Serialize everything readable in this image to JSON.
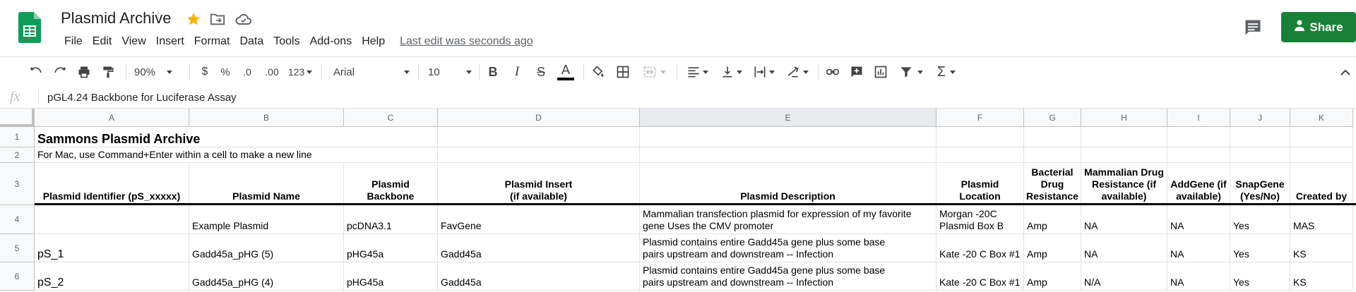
{
  "app": {
    "title": "Plasmid Archive",
    "menus": [
      "File",
      "Edit",
      "View",
      "Insert",
      "Format",
      "Data",
      "Tools",
      "Add-ons",
      "Help"
    ],
    "last_edit": "Last edit was seconds ago",
    "share_label": "Share",
    "colors": {
      "share": "#188038",
      "sheets_green": "#0f9d58",
      "star": "#f4b400"
    }
  },
  "toolbar": {
    "zoom": "90%",
    "currency": "$",
    "percent": "%",
    "dec_less": ".0",
    "dec_more": ".00",
    "more_formats": "123",
    "font": "Arial",
    "font_size": "10",
    "icons": [
      "undo-icon",
      "redo-icon",
      "print-icon",
      "paint-format-icon",
      "bold-icon",
      "italic-icon",
      "strikethrough-icon",
      "text-color-icon",
      "fill-color-icon",
      "borders-icon",
      "merge-icon",
      "align-left-icon",
      "valign-bottom-icon",
      "wrap-icon",
      "rotate-icon",
      "link-icon",
      "comment-add-icon",
      "chart-icon",
      "filter-icon",
      "functions-icon"
    ]
  },
  "formula_bar": {
    "fx": "fx",
    "content": "pGL4.24 Backbone for Luciferase Assay"
  },
  "columns": [
    "A",
    "B",
    "C",
    "D",
    "E",
    "F",
    "G",
    "H",
    "I",
    "J",
    "K"
  ],
  "rows": [
    "1",
    "2",
    "3",
    "4",
    "5",
    "6"
  ],
  "sheet": {
    "title": "Sammons Plasmid Archive",
    "note": "For Mac, use Command+Enter within a cell to make a new line",
    "headers": [
      "Plasmid Identifier (pS_xxxxx)",
      "Plasmid Name",
      "Plasmid Backbone",
      "Plasmid Insert (if available)",
      "Plasmid Description",
      "Plasmid Location",
      "Bacterial Drug Resistance",
      "Mammalian Drug Resistance (if available)",
      "AddGene (if available)",
      "SnapGene (Yes/No)",
      "Created by"
    ],
    "data": [
      [
        "",
        "Example Plasmid",
        "pcDNA3.1",
        "FavGene",
        "Mammalian transfection plasmid for expression of my favorite gene Uses the CMV promoter",
        "Morgan -20C Plasmid Box B",
        "Amp",
        "NA",
        "NA",
        "Yes",
        "MAS"
      ],
      [
        "pS_1",
        "Gadd45a_pHG (5)",
        "pHG45a",
        "Gadd45a",
        "Plasmid contains entire Gadd45a gene plus some base pairs upstream and downstream -- Infection",
        "Kate -20 C Box #1",
        "Amp",
        "NA",
        "NA",
        "Yes",
        "KS"
      ],
      [
        "pS_2",
        "Gadd45a_pHG (4)",
        "pHG45a",
        "Gadd45a",
        "Plasmid contains entire Gadd45a gene plus some base pairs upstream and downstream -- Infection",
        "Kate -20 C Box #1",
        "Amp",
        "N/A",
        "NA",
        "Yes",
        "KS"
      ]
    ]
  }
}
